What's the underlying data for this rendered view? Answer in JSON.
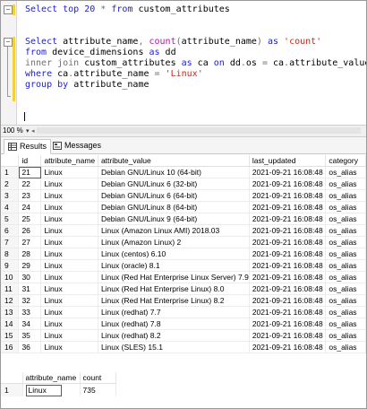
{
  "editor": {
    "lines": [
      [
        {
          "t": "Select top 20 ",
          "c": "kw"
        },
        {
          "t": "* ",
          "c": "gray"
        },
        {
          "t": "from",
          "c": "kw"
        },
        {
          "t": " custom_attributes",
          "c": "plain"
        }
      ],
      [],
      [],
      [
        {
          "t": "Select",
          "c": "kw"
        },
        {
          "t": " attribute_name",
          "c": "plain"
        },
        {
          "t": ", ",
          "c": "gray"
        },
        {
          "t": "count",
          "c": "fn"
        },
        {
          "t": "(",
          "c": "gray"
        },
        {
          "t": "attribute_name",
          "c": "plain"
        },
        {
          "t": ") ",
          "c": "gray"
        },
        {
          "t": "as",
          "c": "kw"
        },
        {
          "t": " ",
          "c": "plain"
        },
        {
          "t": "'count'",
          "c": "str"
        }
      ],
      [
        {
          "t": "from",
          "c": "kw"
        },
        {
          "t": " device_dimensions ",
          "c": "plain"
        },
        {
          "t": "as",
          "c": "kw"
        },
        {
          "t": " dd",
          "c": "plain"
        }
      ],
      [
        {
          "t": "inner join",
          "c": "gray"
        },
        {
          "t": " custom_attributes ",
          "c": "plain"
        },
        {
          "t": "as",
          "c": "kw"
        },
        {
          "t": " ca ",
          "c": "plain"
        },
        {
          "t": "on",
          "c": "kw"
        },
        {
          "t": " dd",
          "c": "plain"
        },
        {
          "t": ".",
          "c": "gray"
        },
        {
          "t": "os ",
          "c": "plain"
        },
        {
          "t": "=",
          "c": "gray"
        },
        {
          "t": " ca",
          "c": "plain"
        },
        {
          "t": ".",
          "c": "gray"
        },
        {
          "t": "attribute_value",
          "c": "plain"
        }
      ],
      [
        {
          "t": "where",
          "c": "kw"
        },
        {
          "t": " ca",
          "c": "plain"
        },
        {
          "t": ".",
          "c": "gray"
        },
        {
          "t": "attribute_name ",
          "c": "plain"
        },
        {
          "t": "=",
          "c": "gray"
        },
        {
          "t": " ",
          "c": "plain"
        },
        {
          "t": "'Linux'",
          "c": "str"
        }
      ],
      [
        {
          "t": "group by",
          "c": "kw"
        },
        {
          "t": " attribute_name",
          "c": "plain"
        }
      ]
    ]
  },
  "zoom": {
    "value": "100 %"
  },
  "tabs": {
    "results": "Results",
    "messages": "Messages"
  },
  "grid1": {
    "columns": [
      "",
      "id",
      "attribute_name",
      "attribute_value",
      "last_updated",
      "category"
    ],
    "rows": [
      [
        "1",
        "21",
        "Linux",
        "Debian GNU/Linux 10 (64-bit)",
        "2021-09-21 16:08:48",
        "os_alias"
      ],
      [
        "2",
        "22",
        "Linux",
        "Debian GNU/Linux 6 (32-bit)",
        "2021-09-21 16:08:48",
        "os_alias"
      ],
      [
        "3",
        "23",
        "Linux",
        "Debian GNU/Linux 6 (64-bit)",
        "2021-09-21 16:08:48",
        "os_alias"
      ],
      [
        "4",
        "24",
        "Linux",
        "Debian GNU/Linux 8 (64-bit)",
        "2021-09-21 16:08:48",
        "os_alias"
      ],
      [
        "5",
        "25",
        "Linux",
        "Debian GNU/Linux 9 (64-bit)",
        "2021-09-21 16:08:48",
        "os_alias"
      ],
      [
        "6",
        "26",
        "Linux",
        "Linux (Amazon Linux AMI) 2018.03",
        "2021-09-21 16:08:48",
        "os_alias"
      ],
      [
        "7",
        "27",
        "Linux",
        "Linux (Amazon Linux) 2",
        "2021-09-21 16:08:48",
        "os_alias"
      ],
      [
        "8",
        "28",
        "Linux",
        "Linux (centos) 6.10",
        "2021-09-21 16:08:48",
        "os_alias"
      ],
      [
        "9",
        "29",
        "Linux",
        "Linux (oracle) 8.1",
        "2021-09-21 16:08:48",
        "os_alias"
      ],
      [
        "10",
        "30",
        "Linux",
        "Linux (Red Hat Enterprise Linux Server) 7.9",
        "2021-09-21 16:08:48",
        "os_alias"
      ],
      [
        "11",
        "31",
        "Linux",
        "Linux (Red Hat Enterprise Linux) 8.0",
        "2021-09-21 16:08:48",
        "os_alias"
      ],
      [
        "12",
        "32",
        "Linux",
        "Linux (Red Hat Enterprise Linux) 8.2",
        "2021-09-21 16:08:48",
        "os_alias"
      ],
      [
        "13",
        "33",
        "Linux",
        "Linux (redhat) 7.7",
        "2021-09-21 16:08:48",
        "os_alias"
      ],
      [
        "14",
        "34",
        "Linux",
        "Linux (redhat) 7.8",
        "2021-09-21 16:08:48",
        "os_alias"
      ],
      [
        "15",
        "35",
        "Linux",
        "Linux (redhat) 8.2",
        "2021-09-21 16:08:48",
        "os_alias"
      ],
      [
        "16",
        "36",
        "Linux",
        "Linux (SLES) 15.1",
        "2021-09-21 16:08:48",
        "os_alias"
      ]
    ]
  },
  "grid2": {
    "columns": [
      "",
      "attribute_name",
      "count"
    ],
    "rows": [
      [
        "1",
        "Linux",
        "735"
      ]
    ]
  }
}
